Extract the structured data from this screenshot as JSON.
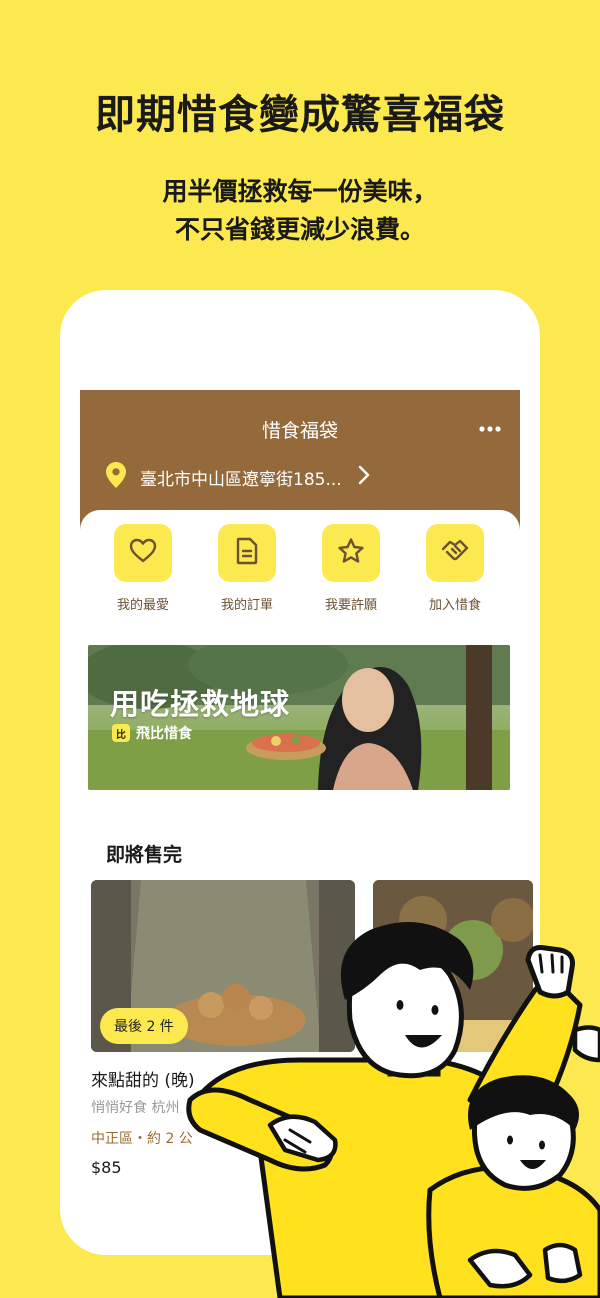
{
  "promo": {
    "headline": "即期惜食變成驚喜福袋",
    "sub_line1": "用半價拯救每一份美味，",
    "sub_line2": "不只省錢更減少浪費。"
  },
  "header": {
    "title": "惜食福袋",
    "address": "臺北市中山區遼寧街185..."
  },
  "quick_actions": [
    {
      "label": "我的最愛",
      "icon": "heart-icon"
    },
    {
      "label": "我的訂單",
      "icon": "document-icon"
    },
    {
      "label": "我要許願",
      "icon": "star-icon"
    },
    {
      "label": "加入惜食",
      "icon": "handshake-icon"
    }
  ],
  "banner": {
    "title": "用吃拯救地球",
    "brand_logo": "比",
    "brand": "飛比惜食"
  },
  "section": {
    "title": "即將售完"
  },
  "cards": [
    {
      "badge": "最後 2 件",
      "name": "來點甜的 (晚)",
      "subtitle": "悄悄好食 杭州",
      "location": "中正區・約 2 公",
      "price": "$85"
    }
  ],
  "colors": {
    "background": "#FCE94F",
    "header_brown": "#946A3C",
    "accent_yellow": "#FCE94F",
    "location_brown": "#9A6B33"
  }
}
